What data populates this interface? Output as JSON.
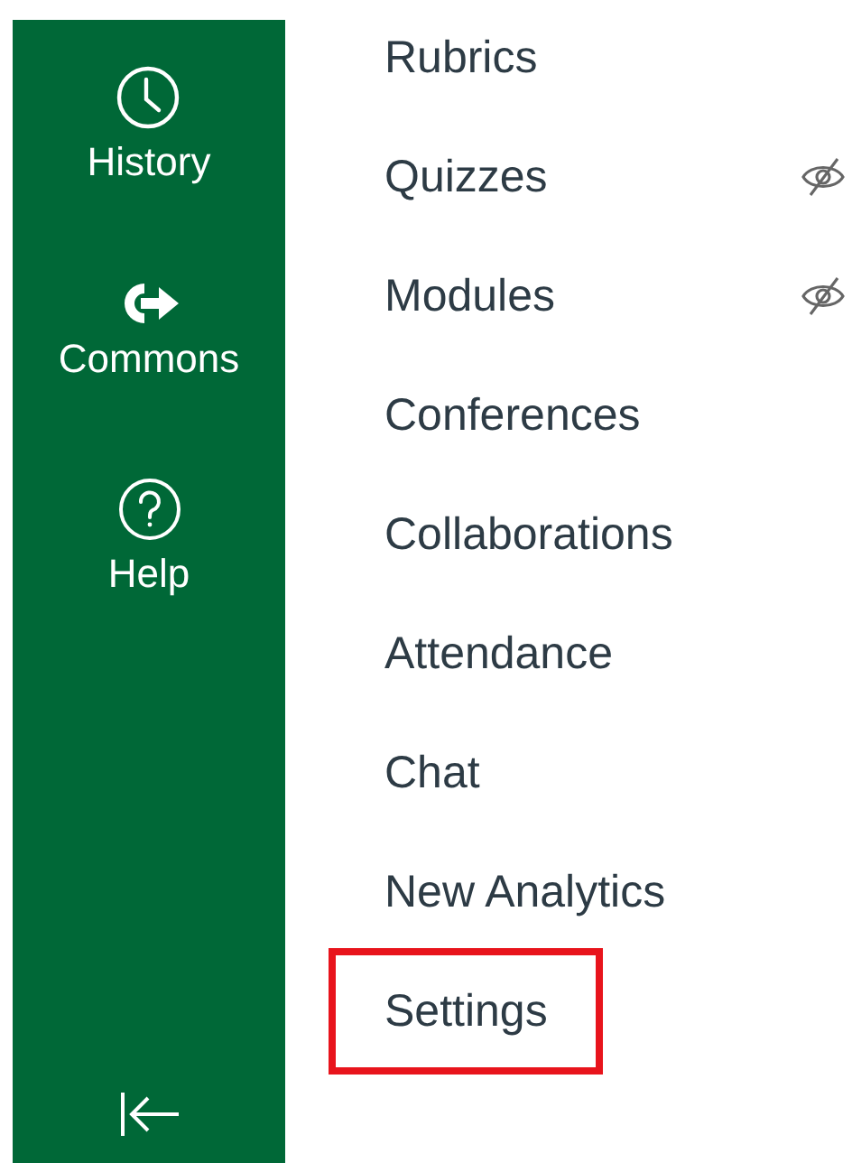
{
  "global_nav": [
    {
      "kind": "history",
      "label": "History"
    },
    {
      "kind": "commons",
      "label": "Commons"
    },
    {
      "kind": "help",
      "label": "Help"
    }
  ],
  "course_nav": [
    {
      "label": "Rubrics",
      "hidden": false,
      "highlighted": false
    },
    {
      "label": "Quizzes",
      "hidden": true,
      "highlighted": false
    },
    {
      "label": "Modules",
      "hidden": true,
      "highlighted": false
    },
    {
      "label": "Conferences",
      "hidden": false,
      "highlighted": false
    },
    {
      "label": "Collaborations",
      "hidden": false,
      "highlighted": false
    },
    {
      "label": "Attendance",
      "hidden": false,
      "highlighted": false
    },
    {
      "label": "Chat",
      "hidden": false,
      "highlighted": false
    },
    {
      "label": "New Analytics",
      "hidden": false,
      "highlighted": false
    },
    {
      "label": "Settings",
      "hidden": false,
      "highlighted": true
    }
  ]
}
